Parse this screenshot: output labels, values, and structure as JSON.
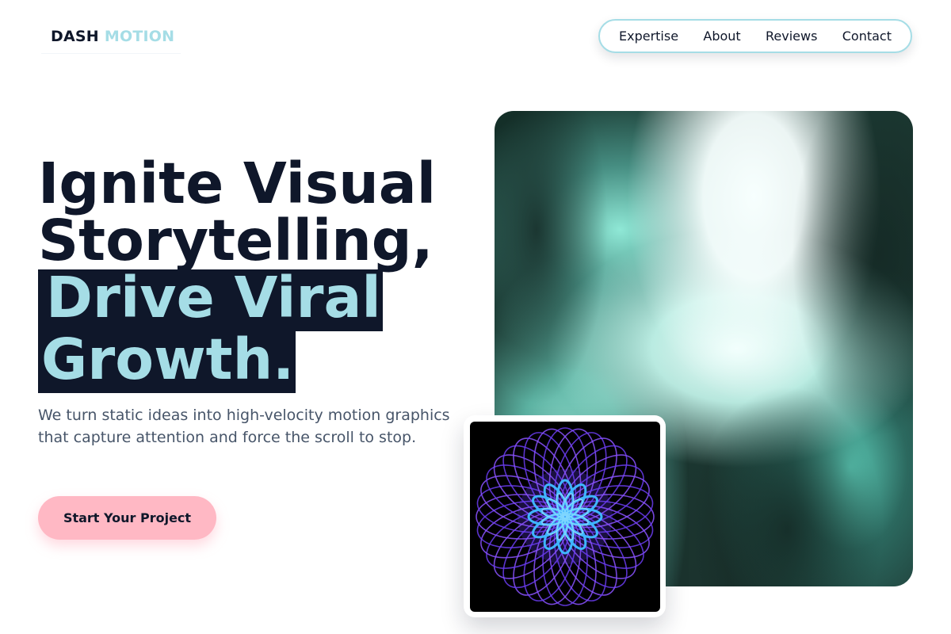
{
  "brand": {
    "name_main": "DASH",
    "name_accent": "MOTION"
  },
  "nav": {
    "items": [
      {
        "label": "Expertise"
      },
      {
        "label": "About"
      },
      {
        "label": "Reviews"
      },
      {
        "label": "Contact"
      }
    ]
  },
  "hero": {
    "headline_line1": "Ignite Visual",
    "headline_line2": "Storytelling,",
    "headline_highlight1": "Drive Viral",
    "headline_highlight2": "Growth.",
    "subtext": "We turn static ideas into high-velocity motion graphics that capture attention and force the scroll to stop.",
    "cta_label": "Start Your Project"
  },
  "colors": {
    "navy": "#0f172a",
    "accent_teal": "#a5dde6",
    "cta_pink": "#ffb8c4",
    "body_text": "#475569"
  },
  "icons": {
    "hero_visual": "abstract-teal-gradient-image",
    "inset_visual": "mandala-spirograph-image"
  }
}
